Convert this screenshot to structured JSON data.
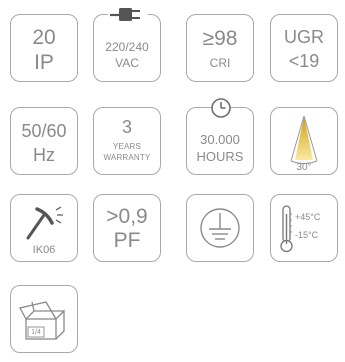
{
  "accent_color": "#f0c419",
  "tiles": {
    "ip": {
      "value": "20",
      "label": "IP"
    },
    "voltage": {
      "value": "220/240",
      "label": "VAC",
      "icon": "plug-icon"
    },
    "cri": {
      "value": "≥98",
      "label": "CRI"
    },
    "ugr": {
      "value": "UGR",
      "label": "<19"
    },
    "frequency": {
      "value": "50/60",
      "label": "Hz"
    },
    "warranty": {
      "value": "3",
      "line1": "YEARS",
      "line2": "WARRANTY"
    },
    "lifetime": {
      "value": "30.000",
      "label": "HOURS",
      "icon": "clock-icon"
    },
    "beam": {
      "angle": "30°",
      "icon": "beam-angle-icon"
    },
    "impact": {
      "label": "IK06",
      "icon": "hammer-icon"
    },
    "power_factor": {
      "value": ">0,9",
      "label": "PF"
    },
    "earth": {
      "icon": "earth-ground-icon"
    },
    "temperature": {
      "max": "+45°C",
      "min": "-15°C",
      "icon": "thermometer-icon"
    },
    "packaging": {
      "label": "1/4",
      "icon": "box-icon"
    }
  }
}
